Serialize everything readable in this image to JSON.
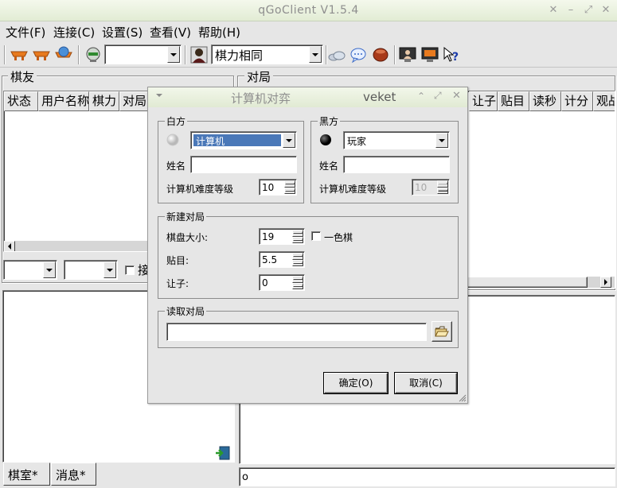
{
  "window": {
    "title": "qGoClient  V1.5.4"
  },
  "menu": [
    "文件(F)",
    "连接(C)",
    "设置(S)",
    "查看(V)",
    "帮助(H)"
  ],
  "toolbar": {
    "combo1_value": "",
    "rating_combo_value": "棋力相同"
  },
  "players_panel": {
    "title": "棋友",
    "columns": [
      "状态",
      "用户名称",
      "棋力",
      "对局"
    ],
    "filter_checkbox_label": "接"
  },
  "games_panel": {
    "title": "对局",
    "columns_right": [
      "让子",
      "贴目",
      "读秒",
      "计分",
      "观战"
    ]
  },
  "tabs": [
    "棋室*",
    "消息*"
  ],
  "chat_input_value": "o",
  "dialog": {
    "title": "计算机对弈",
    "user": "veket",
    "white": {
      "title": "白方",
      "player_type": "计算机",
      "name_label": "姓名",
      "name_value": "",
      "level_label": "计算机难度等级",
      "level_value": "10"
    },
    "black": {
      "title": "黑方",
      "player_type": "玩家",
      "name_label": "姓名",
      "name_value": "",
      "level_label": "计算机难度等级",
      "level_value": "10"
    },
    "new_game": {
      "title": "新建对局",
      "size_label": "棋盘大小:",
      "size_value": "19",
      "mono_label": "一色棋",
      "komi_label": "贴目:",
      "komi_value": "5.5",
      "handicap_label": "让子:",
      "handicap_value": "0"
    },
    "load_game": {
      "title": "读取对局",
      "path_value": ""
    },
    "ok_label": "确定(O)",
    "cancel_label": "取消(C)"
  }
}
